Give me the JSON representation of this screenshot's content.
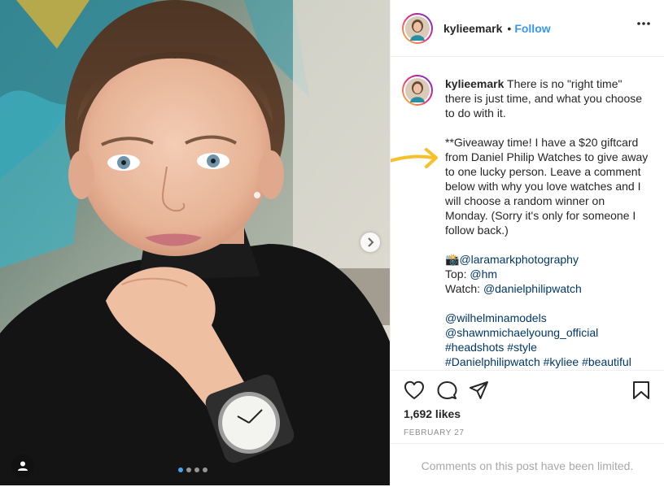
{
  "header": {
    "username": "kylieemark",
    "separator": "•",
    "follow_label": "Follow",
    "more_icon": "more-horizontal-icon"
  },
  "caption": {
    "username": "kylieemark",
    "line1": " There is no \"right time\" there is just time, and what you choose to do with it.",
    "giveaway": "**Giveaway time! I have a $20 giftcard from Daniel Philip Watches to give away to one lucky person. Leave a comment below with why you love watches and I will choose a random winner on Monday. (Sorry it's only for someone I follow back.)",
    "camera_emoji": "📸",
    "photographer": "@laramarkphotography",
    "top_label": "Top: ",
    "top_tag": "@hm",
    "watch_label": "Watch: ",
    "watch_tag": "@danielphilipwatch",
    "agency": "@wilhelminamodels",
    "stylist": "@shawnmichaelyoung_official",
    "tags_line1": "#headshots #style",
    "tags_line2": "#Danielphilipwatch #kyliee #beautiful"
  },
  "stats": {
    "likes": "1,692 likes",
    "date": "FEBRUARY 27"
  },
  "comments": {
    "limited_notice": "Comments on this post have been limited."
  },
  "carousel": {
    "slide_count": 4,
    "active_slide": 1
  },
  "colors": {
    "accent": "#3897f0",
    "link": "#00376b",
    "annotation_arrow": "#f5c02a"
  }
}
